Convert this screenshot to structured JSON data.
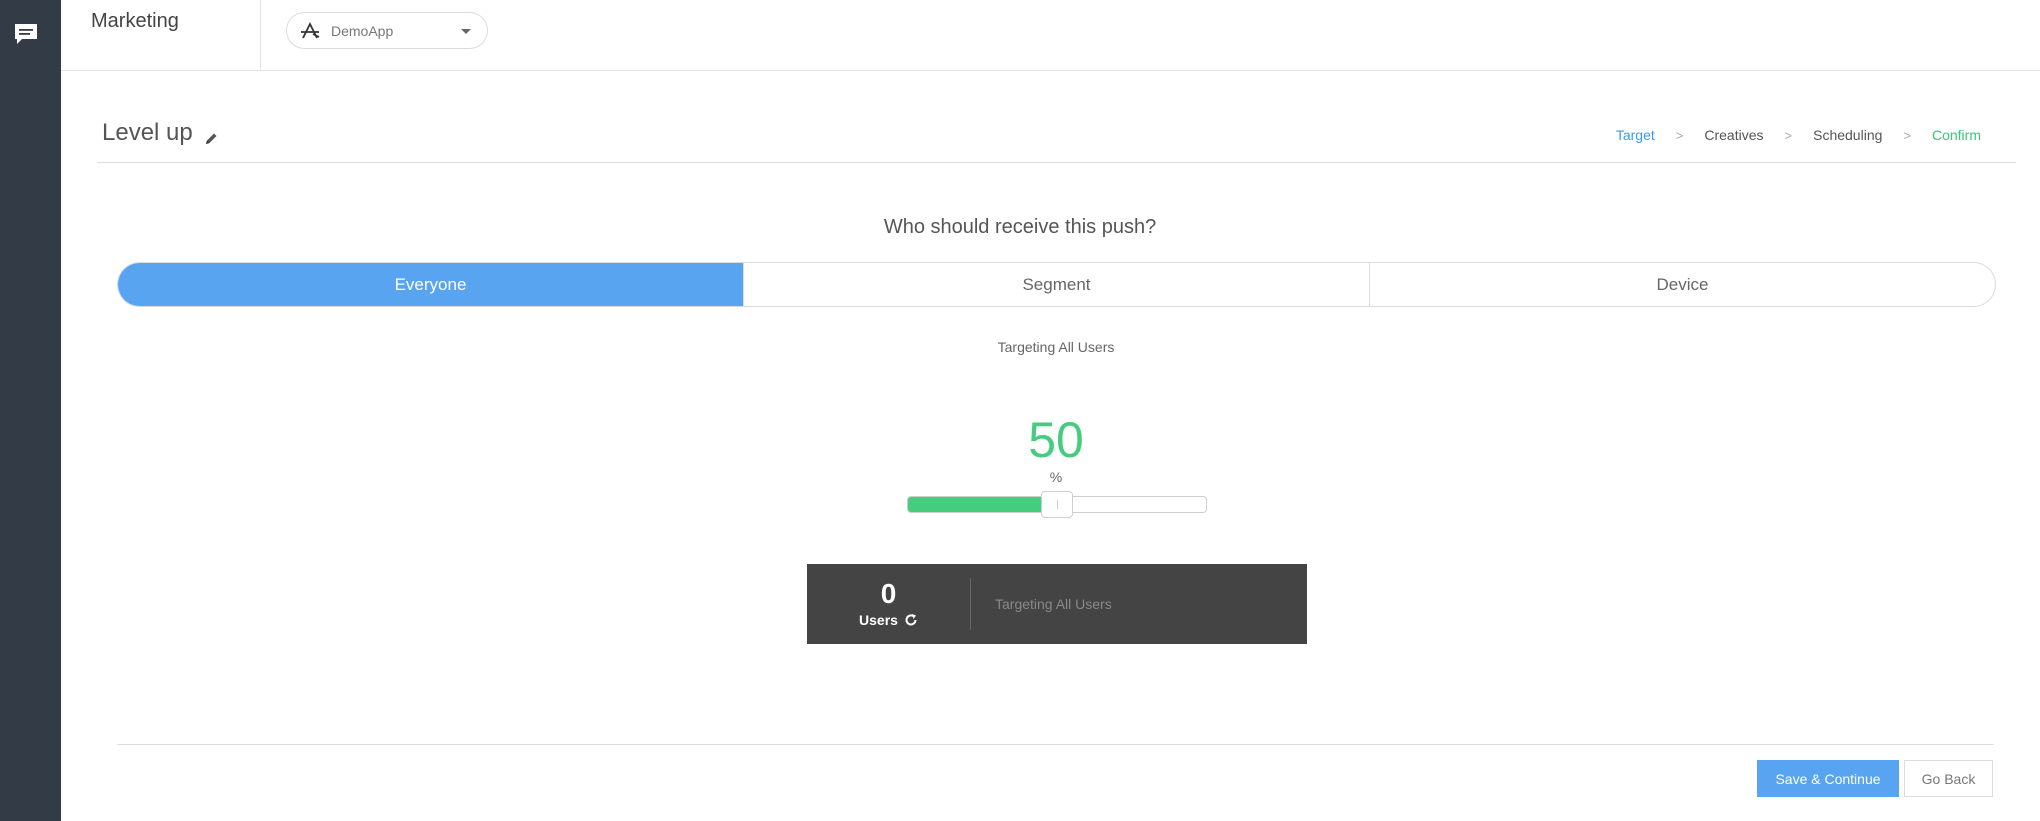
{
  "sidebar": {
    "icon": "chat-icon"
  },
  "topbar": {
    "section_title": "Marketing",
    "app_selector": {
      "name": "DemoApp",
      "icon": "app-store-icon"
    }
  },
  "header": {
    "title": "Level up",
    "steps": [
      {
        "label": "Target",
        "state": "active"
      },
      {
        "label": "Creatives",
        "state": "pending"
      },
      {
        "label": "Scheduling",
        "state": "pending"
      },
      {
        "label": "Confirm",
        "state": "done"
      }
    ],
    "separator": ">"
  },
  "target": {
    "question": "Who should receive this push?",
    "tabs": [
      "Everyone",
      "Segment",
      "Device"
    ],
    "selected_tab": "Everyone",
    "targeting_label": "Targeting All Users",
    "percent": {
      "value": "50",
      "unit": "%",
      "fraction": 0.5
    },
    "stats": {
      "count": "0",
      "users_label": "Users",
      "description": "Targeting All Users"
    }
  },
  "footer": {
    "save_label": "Save & Continue",
    "back_label": "Go Back"
  },
  "colors": {
    "sidebar": "#323b46",
    "accent_blue": "#58a4f1",
    "accent_green": "#45cc7f",
    "stats_bg": "#444444"
  }
}
